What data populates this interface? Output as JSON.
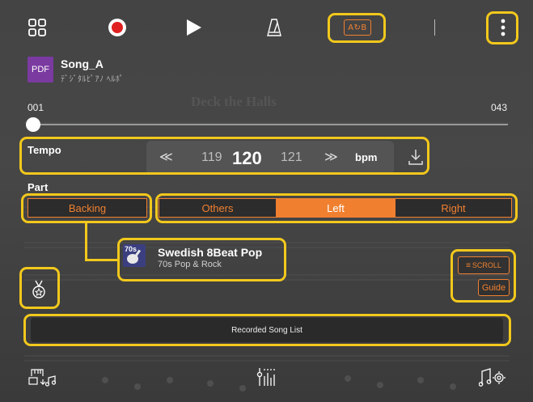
{
  "toolbar": {
    "menu_icon": "grid-icon",
    "record_icon": "record-icon",
    "play_icon": "play-icon",
    "metronome_icon": "metronome-icon",
    "ab_label": "A↻B",
    "more_icon": "more-vertical-icon"
  },
  "song": {
    "badge": "PDF",
    "name": "Song_A",
    "subtitle": "ﾃﾞｼﾞﾀﾙﾋﾟｱﾉ ﾍﾙﾎﾟ"
  },
  "position": {
    "start": "001",
    "end": "043",
    "progress": 0.0
  },
  "tempo": {
    "label": "Tempo",
    "prev": "119",
    "current": "120",
    "next": "121",
    "unit": "bpm"
  },
  "part": {
    "label": "Part",
    "backing": "Backing",
    "others": "Others",
    "left": "Left",
    "right": "Right",
    "active": [
      "Left"
    ]
  },
  "style": {
    "name": "Swedish 8Beat Pop",
    "category": "70s Pop & Rock",
    "thumb_text": "70s"
  },
  "side": {
    "scroll_label": "SCROLL",
    "guide_label": "Guide"
  },
  "recorded": {
    "label": "Recorded Song List"
  },
  "sheet": {
    "title": "Deck the Halls"
  },
  "colors": {
    "accent": "#f08030",
    "highlight": "#f2c81c",
    "record": "#e02020"
  }
}
